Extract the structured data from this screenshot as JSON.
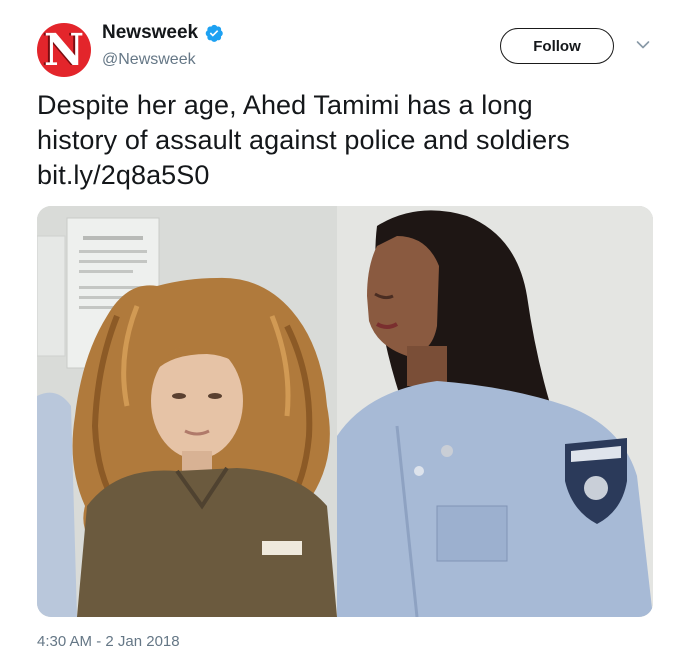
{
  "account": {
    "display_name": "Newsweek",
    "handle": "@Newsweek",
    "avatar_letter": "N",
    "avatar_color": "#e3252b",
    "verified": true,
    "verified_color": "#1da1f2"
  },
  "actions": {
    "follow_label": "Follow"
  },
  "tweet": {
    "text_line1": "Despite her age, Ahed Tamimi has a long",
    "text_line2": "history of assault against police and soldiers",
    "link": "bit.ly/2q8a5S0"
  },
  "media": {
    "description_icon": "photo"
  },
  "footer": {
    "timestamp": "4:30 AM - 2 Jan 2018"
  }
}
